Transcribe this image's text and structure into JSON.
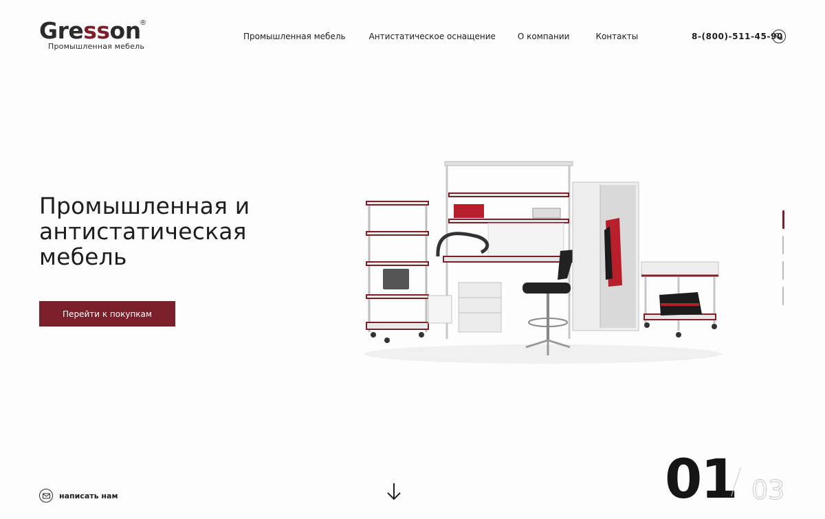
{
  "header": {
    "logo": {
      "word_start": "Gre",
      "word_accent": "ss",
      "word_end": "on",
      "registered": "®",
      "subtitle": "Промышленная   мебель"
    },
    "nav": [
      {
        "label": "Промышленная мебель"
      },
      {
        "label": "Антистатическое оснащение"
      },
      {
        "label": "О компании"
      },
      {
        "label": "Контакты"
      }
    ],
    "phone": "8-(800)-511-45-90",
    "phone_icon": "phone-icon"
  },
  "hero": {
    "title": "Промышленная и антистатическая мебель",
    "cta_label": "Перейти к покупкам",
    "image_icon": "furniture-set-illustration"
  },
  "slider": {
    "current": "01",
    "total": "03",
    "active_index": 1,
    "indicator_count": 4
  },
  "footer": {
    "write_label": "написать нам",
    "write_icon": "mail-icon",
    "scroll_icon": "arrow-down-icon"
  },
  "colors": {
    "accent": "#7b1f2a",
    "text": "#1d1d1d",
    "background": "#fdfdfd"
  }
}
